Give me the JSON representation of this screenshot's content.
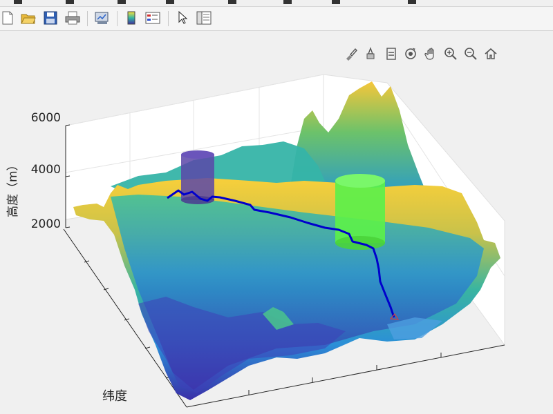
{
  "toolbar": {
    "buttons": [
      "new-figure",
      "open-file",
      "save-figure",
      "print-figure",
      "link-plot",
      "insert-colorbar",
      "insert-legend",
      "edit-plot",
      "property-inspector"
    ]
  },
  "axes_toolbar": {
    "buttons": [
      "brush-icon",
      "data-tips-icon",
      "export-icon",
      "rotate-3d-icon",
      "pan-icon",
      "zoom-in-icon",
      "zoom-out-icon",
      "restore-view-icon"
    ]
  },
  "chart_data": {
    "type": "surface",
    "zlabel": "高度（m）",
    "ylabel": "纬度",
    "z_ticks": [
      "2000",
      "4000",
      "6000"
    ],
    "z_range": [
      2000,
      6000
    ],
    "grid": true,
    "colormap": "parula",
    "path_color": "#0000cc",
    "obstacles": [
      {
        "shape": "cylinder",
        "color": "#5b46a8"
      },
      {
        "shape": "cylinder",
        "color": "#5cf04a"
      }
    ]
  }
}
